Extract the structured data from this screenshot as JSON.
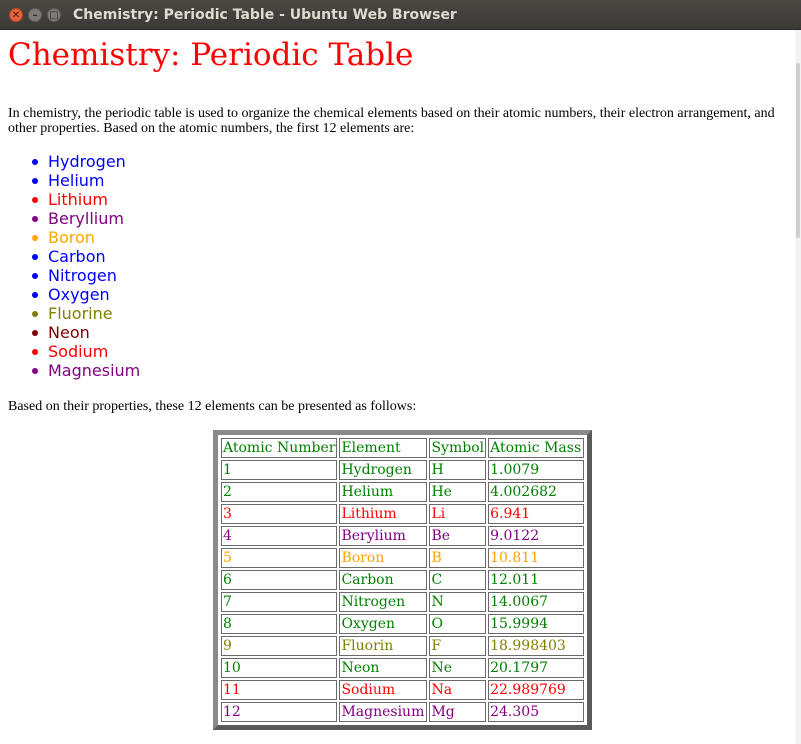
{
  "window": {
    "title": "Chemistry: Periodic Table - Ubuntu Web Browser",
    "close_glyph": "✕",
    "min_glyph": "–",
    "max_glyph": "□"
  },
  "page": {
    "heading": "Chemistry: Periodic Table",
    "intro": "In chemistry, the periodic table is used to organize the chemical elements based on their atomic numbers, their electron arrangement, and other properties. Based on the atomic numbers, the first 12 elements are:",
    "outro": "Based on their properties, these 12 elements can be presented as follows:",
    "heading_color": "#ff0000"
  },
  "list": [
    {
      "name": "Hydrogen",
      "color": "#0000ff"
    },
    {
      "name": "Helium",
      "color": "#0000ff"
    },
    {
      "name": "Lithium",
      "color": "#ff0000"
    },
    {
      "name": "Beryllium",
      "color": "#800080"
    },
    {
      "name": "Boron",
      "color": "#ffa500"
    },
    {
      "name": "Carbon",
      "color": "#0000ff"
    },
    {
      "name": "Nitrogen",
      "color": "#0000ff"
    },
    {
      "name": "Oxygen",
      "color": "#0000ff"
    },
    {
      "name": "Fluorine",
      "color": "#808000"
    },
    {
      "name": "Neon",
      "color": "#800000"
    },
    {
      "name": "Sodium",
      "color": "#ff0000"
    },
    {
      "name": "Magnesium",
      "color": "#800080"
    }
  ],
  "table": {
    "headers": [
      "Atomic Number",
      "Element",
      "Symbol",
      "Atomic Mass"
    ],
    "rows": [
      {
        "num": "1",
        "element": "Hydrogen",
        "symbol": "H",
        "mass": "1.0079",
        "color": "#008000"
      },
      {
        "num": "2",
        "element": "Helium",
        "symbol": "He",
        "mass": "4.002682",
        "color": "#008000"
      },
      {
        "num": "3",
        "element": "Lithium",
        "symbol": "Li",
        "mass": "6.941",
        "color": "#ff0000"
      },
      {
        "num": "4",
        "element": "Berylium",
        "symbol": "Be",
        "mass": "9.0122",
        "color": "#800080"
      },
      {
        "num": "5",
        "element": "Boron",
        "symbol": "B",
        "mass": "10.811",
        "color": "#ffa500"
      },
      {
        "num": "6",
        "element": "Carbon",
        "symbol": "C",
        "mass": "12.011",
        "color": "#008000"
      },
      {
        "num": "7",
        "element": "Nitrogen",
        "symbol": "N",
        "mass": "14.0067",
        "color": "#008000"
      },
      {
        "num": "8",
        "element": "Oxygen",
        "symbol": "O",
        "mass": "15.9994",
        "color": "#008000"
      },
      {
        "num": "9",
        "element": "Fluorin",
        "symbol": "F",
        "mass": "18.998403",
        "color": "#808000"
      },
      {
        "num": "10",
        "element": "Neon",
        "symbol": "Ne",
        "mass": "20.1797",
        "color": "#008000"
      },
      {
        "num": "11",
        "element": "Sodium",
        "symbol": "Na",
        "mass": "22.989769",
        "color": "#ff0000"
      },
      {
        "num": "12",
        "element": "Magnesium",
        "symbol": "Mg",
        "mass": "24.305",
        "color": "#800080"
      }
    ]
  }
}
